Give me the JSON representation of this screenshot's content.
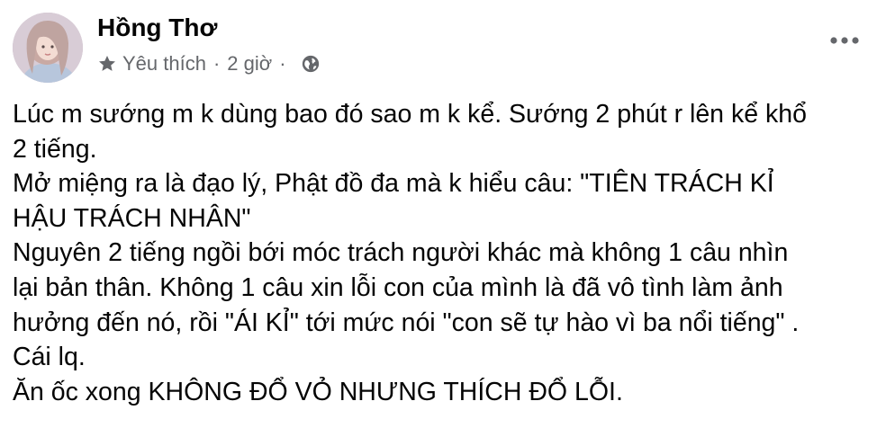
{
  "post": {
    "author": "Hồng Thơ",
    "icons": {
      "avatar": "profile-avatar",
      "privacy_star": "star-icon",
      "audience": "globe-icon",
      "menu": "more-horizontal-icon"
    },
    "meta": {
      "category": "Yêu thích",
      "separator_1": "·",
      "time": "2 giờ",
      "separator_2": "·"
    },
    "body_lines": [
      "Lúc m sướng m k dùng bao đó sao m k kể. Sướng 2 phút r lên kể khổ",
      "2 tiếng.",
      "Mở miệng ra là đạo lý, Phật đồ đa mà k hiểu câu: \"TIÊN TRÁCH KỈ",
      "HẬU TRÁCH NHÂN\"",
      "Nguyên 2 tiếng ngồi bới móc trách người khác mà không 1 câu nhìn",
      "lại bản thân. Không 1 câu xin lỗi con của mình là đã vô tình làm ảnh",
      "hưởng đến nó, rồi \"ÁI KỈ\" tới mức nói \"con sẽ tự hào vì ba nổi tiếng\" .",
      "Cái lq.",
      "Ăn ốc xong KHÔNG ĐỔ VỎ NHƯNG THÍCH ĐỔ LỖI."
    ]
  },
  "colors": {
    "text_primary": "#050505",
    "text_secondary": "#65676b",
    "background": "#ffffff"
  }
}
